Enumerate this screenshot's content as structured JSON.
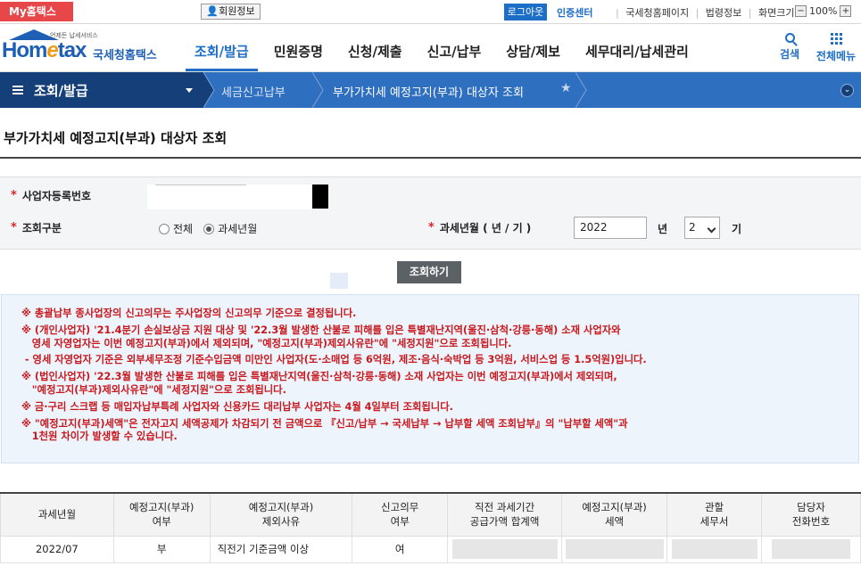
{
  "topbar": {
    "my_hometax": "My홈택스",
    "member_info": "회원정보",
    "logout": "로그아웃",
    "cert_center": "인증센터",
    "links": [
      "국세청홈페이지",
      "법령정보",
      "화면크기"
    ],
    "zoom_minus": "−",
    "zoom_level": "100%",
    "zoom_plus": "+"
  },
  "header": {
    "logo_word_a": "Hom",
    "logo_word_e": "e",
    "logo_word_b": "tax",
    "logo_sub": "언제든 납세서비스",
    "logo_kr": "국세청홈택스",
    "menu": [
      "조회/발급",
      "민원증명",
      "신청/제출",
      "신고/납부",
      "상담/제보",
      "세무대리/납세관리"
    ],
    "search": "검색",
    "all_menu": "전체메뉴"
  },
  "location": {
    "level1": "조회/발급",
    "level2": "세금신고납부",
    "level3": "부가가치세 예정고지(부과) 대상자 조회"
  },
  "page": {
    "title": "부가가치세 예정고지(부과) 대상자 조회"
  },
  "form": {
    "reg_no_label": "사업자등록번호",
    "query_type_label": "조회구분",
    "query_options": [
      "전체",
      "과세년월"
    ],
    "tax_period_label": "과세년월 ( 년 / 기 )",
    "year_value": "2022",
    "year_unit": "년",
    "term_value": "2",
    "term_unit": "기",
    "search_button": "조회하기"
  },
  "notice": [
    "※ 총괄납부 종사업장의 신고의무는 주사업장의 신고의무 기준으로 결정됩니다.",
    "※ (개인사업자) '21.4분기 손실보상금 지원 대상 및 '22.3월 발생한 산불로 피해를 입은 특별재난지역(울진·삼척·강릉·동해) 소재 사업자와\n   영세 자영업자는 이번 예정고지(부과)에서 제외되며, \"예정고지(부과)제외사유란\"에 \"세정지원\"으로 조회됩니다.",
    " - 영세 자영업자 기준은 외부세무조정 기준수입금액 미만인 사업자(도·소매업 등 6억원, 제조·음식·숙박업 등 3억원, 서비스업 등 1.5억원)입니다.",
    "※ (법인사업자) '22.3월 발생한 산불로 피해를 입은 특별재난지역(울진·삼척·강릉·동해) 소재 사업자는 이번 예정고지(부과)에서 제외되며,\n   \"예정고지(부과)제외사유란\"에 \"세정지원\"으로 조회됩니다.",
    "※ 금·구리 스크랩 등 매입자납부특례 사업자와 신용카드 대리납부 사업자는 4월 4일부터 조회됩니다.",
    "※ \"예정고지(부과)세액\"은 전자고지 세액공제가 차감되기 전 금액으로 『신고/납부 → 국세납부 → 납부할 세액 조회납부』의 \"납부할 세액\"과\n   1천원 차이가 발생할 수 있습니다."
  ],
  "table": {
    "headers": [
      "과세년월",
      "예정고지(부과)\n여부",
      "예정고지(부과)\n제외사유",
      "신고의무\n여부",
      "직전 과세기간\n공급가액 합계액",
      "예정고지(부과)\n세액",
      "관할\n세무서",
      "담당자\n전화번호"
    ],
    "rows": [
      {
        "period": "2022/07",
        "notified": "부",
        "reason": "직전기 기준금액 이상",
        "duty": "여"
      }
    ]
  }
}
